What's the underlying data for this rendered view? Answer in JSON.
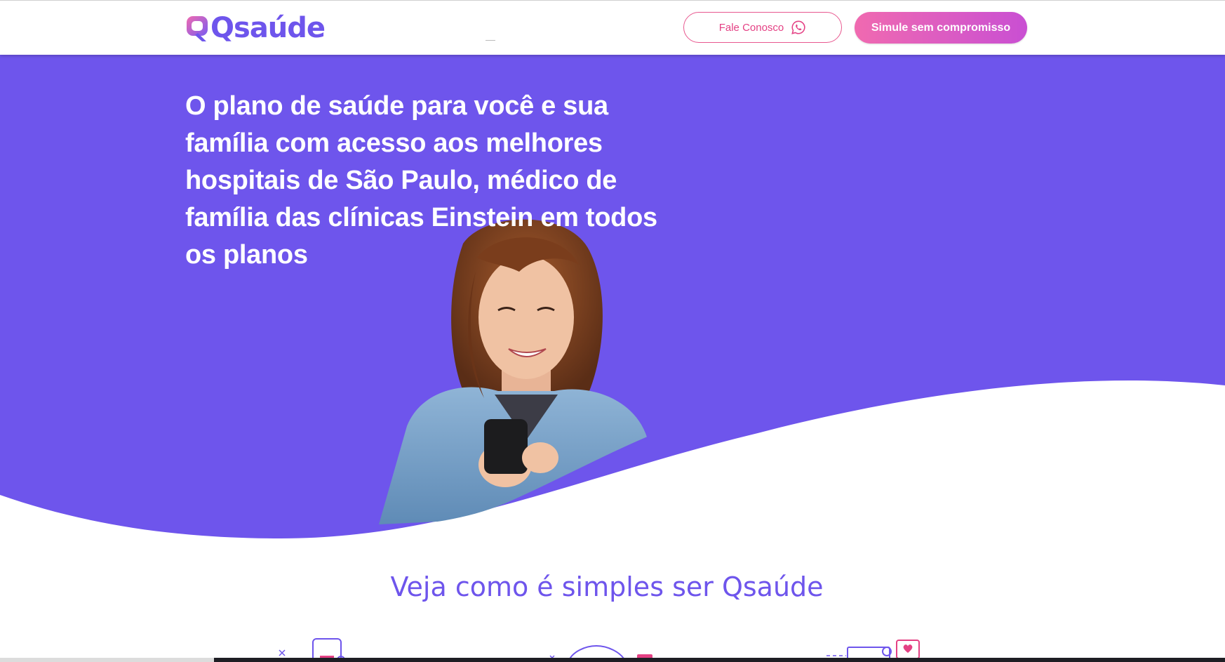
{
  "header": {
    "logo_text": "Qsaúde",
    "contact_button_label": "Fale Conosco",
    "contact_icon": "whatsapp-icon",
    "simulate_button_label": "Simule sem compromisso"
  },
  "hero": {
    "title": "O plano de saúde para você e sua família com acesso aos melhores hospitais de São Paulo, médico de família das clínicas Einstein em todos os planos",
    "image": "woman-with-phone"
  },
  "section": {
    "title": "Veja como é simples ser Qsaúde"
  },
  "colors": {
    "brand_purple": "#6e55ec",
    "brand_pink": "#e44184",
    "gradient_start": "#f06ab0",
    "gradient_end": "#c94fd3"
  }
}
